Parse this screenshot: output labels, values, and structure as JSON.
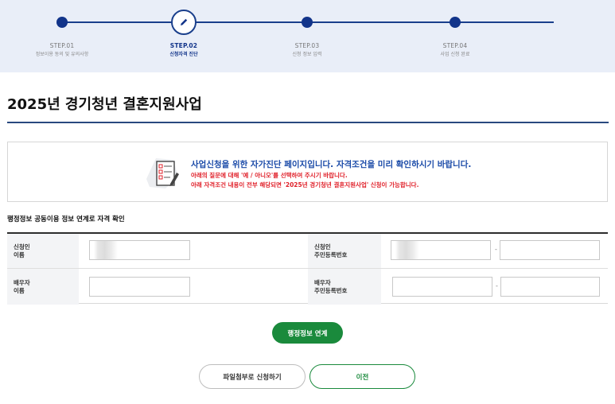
{
  "steps": [
    {
      "num": "STEP.01",
      "label": "정보이용 동의 및 유의사항",
      "active": false
    },
    {
      "num": "STEP.02",
      "label": "신청자격 진단",
      "active": true
    },
    {
      "num": "STEP.03",
      "label": "신청 정보 입력",
      "active": false
    },
    {
      "num": "STEP.04",
      "label": "사업 신청 완료",
      "active": false
    }
  ],
  "active_step_icon": "pencil-icon",
  "page_title": "2025년 경기청년 결혼지원사업",
  "notice": {
    "icon": "checklist-document-icon",
    "main": "사업신청을 위한 자가진단 페이지입니다. 자격조건을 미리 확인하시기 바랍니다.",
    "sub1": "아래의 질문에 대해 '예 / 아니오'를 선택하여 주시기 바랍니다.",
    "sub2": "아래 자격조건 내용이 전부 해당되면 '2025년 경기청년 결혼지원사업' 신청이 가능합니다."
  },
  "section_title": "행정정보 공동이용 정보 연계로 자격 확인",
  "form": {
    "applicant_name_label_1": "신청인",
    "applicant_name_label_2": "이름",
    "applicant_rrn_label_1": "신청인",
    "applicant_rrn_label_2": "주민등록번호",
    "spouse_name_label_1": "배우자",
    "spouse_name_label_2": "이름",
    "spouse_rrn_label_1": "배우자",
    "spouse_rrn_label_2": "주민등록번호",
    "applicant_name_value": "",
    "applicant_rrn_front": "",
    "applicant_rrn_back": "",
    "spouse_name_value": "",
    "spouse_rrn_front": "",
    "spouse_rrn_back": "",
    "dash": "-"
  },
  "buttons": {
    "admin_link": "행정정보 연계",
    "file_apply": "파일첨부로 신청하기",
    "prev": "이전"
  },
  "colors": {
    "navy": "#12348a",
    "green": "#1a8a3c",
    "red": "#e0212a",
    "blue_text": "#1a4aa8",
    "header_bg": "#e9eef8"
  }
}
